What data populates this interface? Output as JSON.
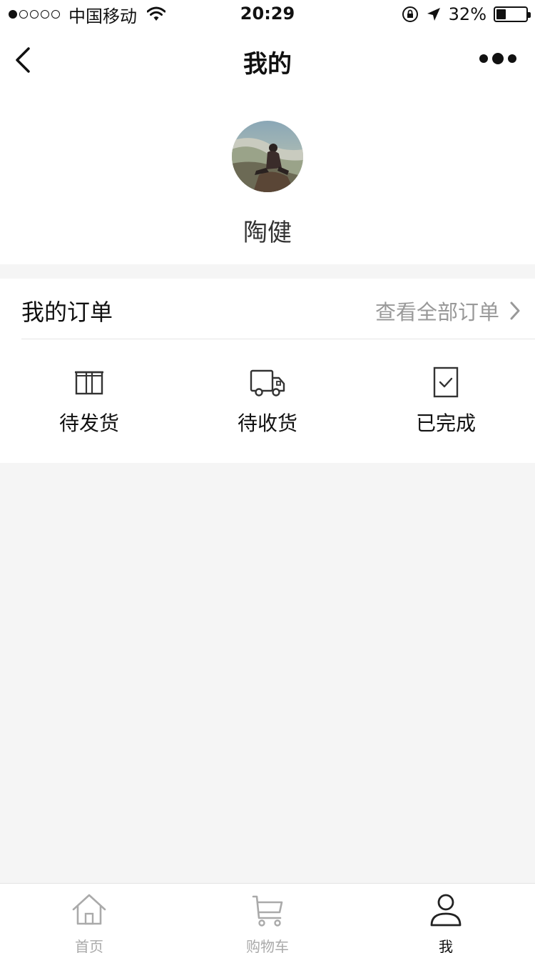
{
  "status_bar": {
    "carrier": "中国移动",
    "time": "20:29",
    "battery_percent": "32%",
    "battery_level": 0.32
  },
  "nav": {
    "title": "我的"
  },
  "profile": {
    "name": "陶健"
  },
  "orders": {
    "title": "我的订单",
    "view_all": "查看全部订单",
    "items": [
      {
        "label": "待发货",
        "icon": "package-icon"
      },
      {
        "label": "待收货",
        "icon": "truck-icon"
      },
      {
        "label": "已完成",
        "icon": "check-document-icon"
      }
    ]
  },
  "tab_bar": {
    "tabs": [
      {
        "label": "首页",
        "icon": "home-icon",
        "active": false
      },
      {
        "label": "购物车",
        "icon": "cart-icon",
        "active": false
      },
      {
        "label": "我",
        "icon": "user-icon",
        "active": true
      }
    ]
  },
  "colors": {
    "page_background": "#f5f5f5",
    "inactive_tab": "#aaaaaa",
    "secondary_text": "#999999"
  }
}
